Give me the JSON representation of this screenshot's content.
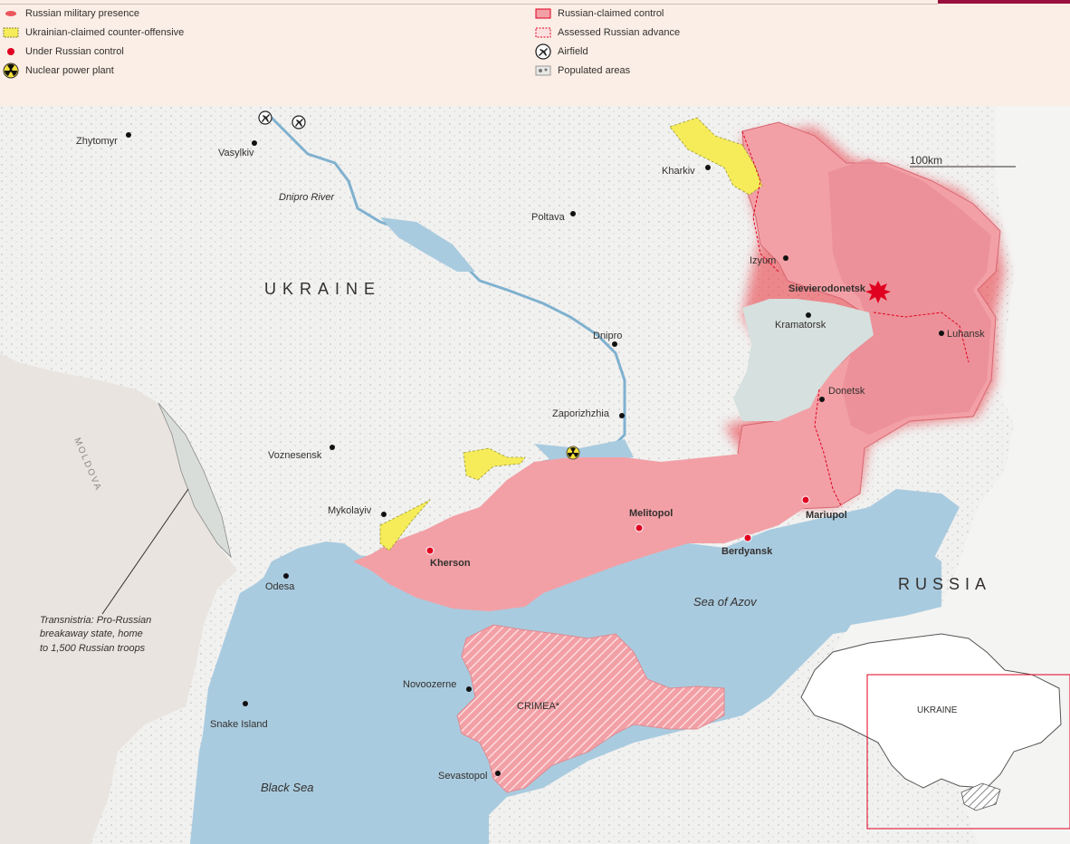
{
  "legend": {
    "russian_military_presence": "Russian military presence",
    "ukrainian_counter_offensive": "Ukrainian-claimed counter-offensive",
    "under_russian_control": "Under Russian control",
    "nuclear_power_plant": "Nuclear power plant",
    "russian_claimed_control": "Russian-claimed control",
    "assessed_russian_advance": "Assessed Russian advance",
    "airfield": "Airfield",
    "populated_areas": "Populated areas"
  },
  "colors": {
    "russian_claimed": "#f2a0a6",
    "russian_presence": "#e8303a",
    "counter_offensive": "#f6ec5a",
    "under_control_dot": "#e00020",
    "water": "#a9cbdf",
    "land": "#f1f1f0",
    "neighbour": "#e9e4df",
    "russia_land": "#f4f4f3",
    "contested_grey": "#d6e0de",
    "accent": "#990f3d"
  },
  "map": {
    "country_ukraine": "UKRAINE",
    "country_russia": "RUSSIA",
    "moldova": "MOLDOVA",
    "scale_label": "100km",
    "river_label": "Dnipro River",
    "sea_black": "Black Sea",
    "sea_azov": "Sea of Azov",
    "crimea": "CRIMEA*",
    "transnistria": [
      "Transnistria: Pro-Russian",
      "breakaway state, home",
      "to 1,500 Russian troops"
    ],
    "cities": {
      "zhytomyr": "Zhytomyr",
      "vasylkiv": "Vasylkiv",
      "kharkiv": "Kharkiv",
      "poltava": "Poltava",
      "izyum": "Izyum",
      "sievierodonetsk": "Sievierodonetsk",
      "kramatorsk": "Kramatorsk",
      "luhansk": "Luhansk",
      "dnipro": "Dnipro",
      "donetsk": "Donetsk",
      "zaporizhzhia": "Zaporizhzhia",
      "voznesensk": "Voznesensk",
      "mykolayiv": "Mykolayiv",
      "melitopol": "Melitopol",
      "mariupol": "Mariupol",
      "berdyansk": "Berdyansk",
      "kherson": "Kherson",
      "odesa": "Odesa",
      "snake_island": "Snake Island",
      "novoozerne": "Novoozerne",
      "sevastopol": "Sevastopol"
    },
    "inset_label": "UKRAINE"
  }
}
